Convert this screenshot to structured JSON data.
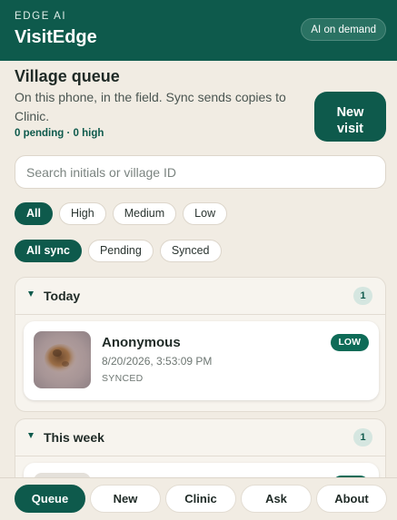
{
  "header": {
    "brand": "EDGE AI",
    "title": "VisitEdge",
    "ai_pill": "AI on demand"
  },
  "queue": {
    "title": "Village queue",
    "subtitle": "On this phone, in the field. Sync sends copies to Clinic.",
    "counts": "0 pending · 0 high",
    "new_visit_line1": "New",
    "new_visit_line2": "visit"
  },
  "search": {
    "placeholder": "Search initials or village ID"
  },
  "priority_filters": [
    {
      "label": "All",
      "active": true
    },
    {
      "label": "High",
      "active": false
    },
    {
      "label": "Medium",
      "active": false
    },
    {
      "label": "Low",
      "active": false
    }
  ],
  "sync_filters": [
    {
      "label": "All sync",
      "active": true
    },
    {
      "label": "Pending",
      "active": false
    },
    {
      "label": "Synced",
      "active": false
    }
  ],
  "sections": [
    {
      "label": "Today",
      "count": "1",
      "visits": [
        {
          "name": "Anonymous",
          "datetime": "8/20/2026, 3:53:09 PM",
          "sync_status": "SYNCED",
          "priority": "LOW"
        }
      ]
    },
    {
      "label": "This week",
      "count": "1",
      "visits": []
    }
  ],
  "bottom_nav": [
    {
      "label": "Queue",
      "active": true
    },
    {
      "label": "New",
      "active": false
    },
    {
      "label": "Clinic",
      "active": false
    },
    {
      "label": "Ask",
      "active": false
    },
    {
      "label": "About",
      "active": false
    }
  ],
  "colors": {
    "brand": "#0e5a4c",
    "background": "#f1ece3",
    "badge_low": "#0e6b57"
  }
}
